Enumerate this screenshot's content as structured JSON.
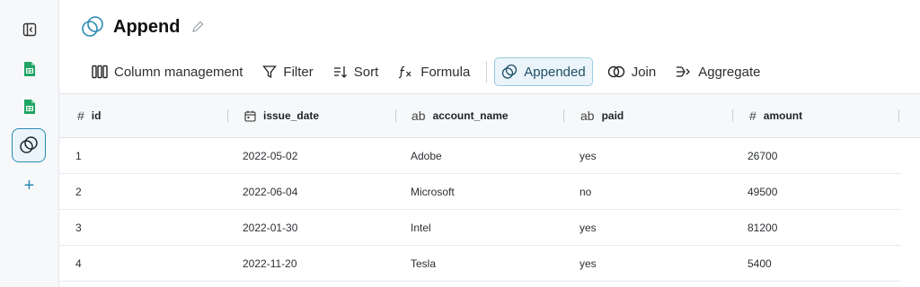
{
  "page": {
    "title": "Append"
  },
  "toolbar": {
    "column_management": "Column management",
    "filter": "Filter",
    "sort": "Sort",
    "formula": "Formula",
    "appended": "Appended",
    "join": "Join",
    "aggregate": "Aggregate"
  },
  "table": {
    "columns": [
      {
        "label": "id",
        "type_icon": "#"
      },
      {
        "label": "issue_date",
        "type_icon": "calendar"
      },
      {
        "label": "account_name",
        "type_icon": "ab"
      },
      {
        "label": "paid",
        "type_icon": "ab"
      },
      {
        "label": "amount",
        "type_icon": "#"
      }
    ],
    "rows": [
      [
        "1",
        "2022-05-02",
        "Adobe",
        "yes",
        "26700"
      ],
      [
        "2",
        "2022-06-04",
        "Microsoft",
        "no",
        "49500"
      ],
      [
        "3",
        "2022-01-30",
        "Intel",
        "yes",
        "81200"
      ],
      [
        "4",
        "2022-11-20",
        "Tesla",
        "yes",
        "5400"
      ]
    ]
  },
  "colors": {
    "accent": "#2a8ab3",
    "sheet_green": "#1fa463"
  }
}
